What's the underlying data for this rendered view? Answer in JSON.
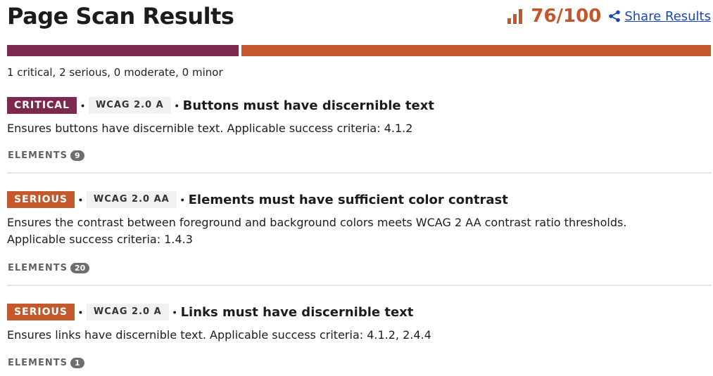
{
  "header": {
    "title": "Page Scan Results",
    "score": "76/100",
    "score_icon": "bar-chart-icon",
    "share_icon": "share-icon",
    "share_label": "Share Results",
    "accent_color": "#c2572b"
  },
  "severity_bar": {
    "critical_share": 0.33,
    "serious_share": 0.67,
    "critical_color": "#7b2a4e",
    "serious_color": "#c2582c"
  },
  "summary": "1 critical, 2 serious, 0 moderate, 0 minor",
  "issues": [
    {
      "impact": "CRITICAL",
      "wcag": "WCAG 2.0 A",
      "rule": "Buttons must have discernible text",
      "description": "Ensures buttons have discernible text. Applicable success criteria: 4.1.2",
      "elements_label": "ELEMENTS",
      "count": "9"
    },
    {
      "impact": "SERIOUS",
      "wcag": "WCAG 2.0 AA",
      "rule": "Elements must have sufficient color contrast",
      "description": "Ensures the contrast between foreground and background colors meets WCAG 2 AA contrast ratio thresholds. Applicable success criteria: 1.4.3",
      "elements_label": "ELEMENTS",
      "count": "20"
    },
    {
      "impact": "SERIOUS",
      "wcag": "WCAG 2.0 A",
      "rule": "Links must have discernible text",
      "description": "Ensures links have discernible text. Applicable success criteria: 4.1.2, 2.4.4",
      "elements_label": "ELEMENTS",
      "count": "1"
    }
  ]
}
